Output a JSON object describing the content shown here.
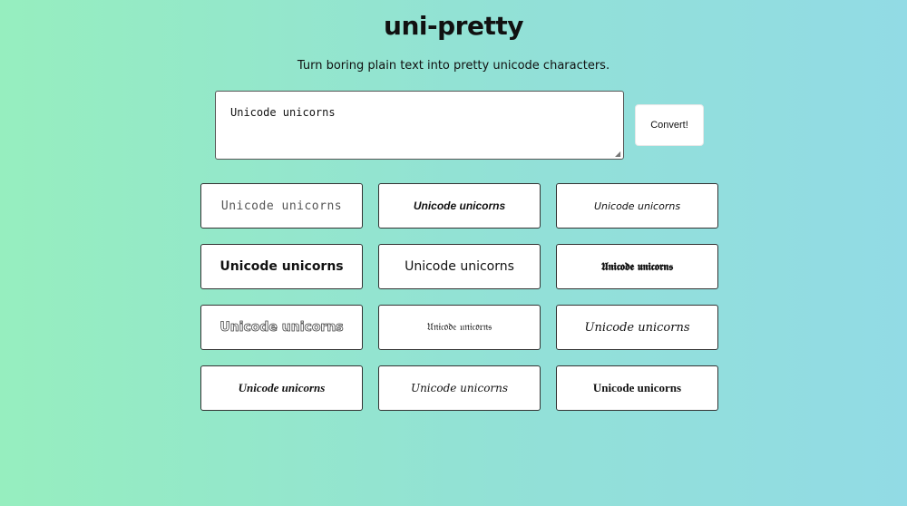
{
  "header": {
    "title": "uni-pretty",
    "subtitle": "Turn boring plain text into pretty unicode characters."
  },
  "input": {
    "value": "Unicode unicorns"
  },
  "convert_button": {
    "label": "Convert!"
  },
  "results": [
    {
      "style": "monospace",
      "text": "Unicode unicorns"
    },
    {
      "style": "sans-bold-italic",
      "text": "Unicode unicorns"
    },
    {
      "style": "sans-italic",
      "text": "Unicode unicorns"
    },
    {
      "style": "sans-bold",
      "text": "Unicode unicorns"
    },
    {
      "style": "sans",
      "text": "Unicode unicorns"
    },
    {
      "style": "fraktur-bold",
      "text": "𝖀𝖓𝖎𝖈𝖔𝖉𝖊 𝖚𝖓𝖎𝖈𝖔𝖗𝖓𝖘"
    },
    {
      "style": "double-struck",
      "text": "Unicode unicorns"
    },
    {
      "style": "fraktur",
      "text": "𝔘𝔫𝔦𝔠𝔬𝔡𝔢 𝔲𝔫𝔦𝔠𝔬𝔯𝔫𝔰"
    },
    {
      "style": "script",
      "text": "Unicode unicorns"
    },
    {
      "style": "serif-bold-italic",
      "text": "Unicode unicorns"
    },
    {
      "style": "serif-italic",
      "text": "Unicode unicorns"
    },
    {
      "style": "serif-bold",
      "text": "Unicode unicorns"
    }
  ]
}
